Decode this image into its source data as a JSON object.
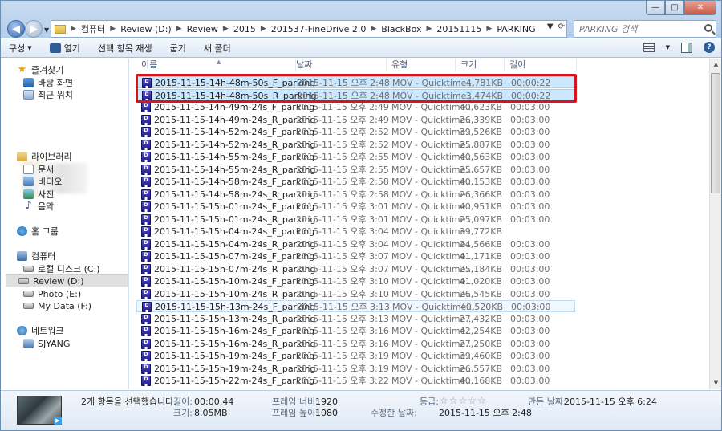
{
  "window": {
    "minimize": "—",
    "maximize": "□",
    "close": "✕"
  },
  "address": {
    "crumbs": [
      "컴퓨터",
      "Review (D:)",
      "Review",
      "2015",
      "201537-FineDrive 2.0",
      "BlackBox",
      "20151115",
      "PARKING"
    ]
  },
  "search": {
    "placeholder": "PARKING 검색"
  },
  "toolbar": {
    "organize": "구성",
    "open": "열기",
    "play_selection": "선택 항목 재생",
    "burn": "굽기",
    "new_folder": "새 폴더"
  },
  "sidebar": {
    "favorites": "즐겨찾기",
    "desktop": "바탕 화면",
    "recent": "최근 위치",
    "libraries": "라이브러리",
    "documents": "문서",
    "videos": "비디오",
    "pictures": "사진",
    "music": "음악",
    "homegroup": "홈 그룹",
    "computer": "컴퓨터",
    "local_disk": "로컬 디스크 (C:)",
    "review_drive": "Review (D:)",
    "photo_drive": "Photo (E:)",
    "mydata_drive": "My Data (F:)",
    "network": "네트워크",
    "host": "SJYANG"
  },
  "columns": {
    "name": "이름",
    "date": "날짜",
    "type": "유형",
    "size": "크기",
    "length": "길이"
  },
  "files": [
    {
      "name": "2015-11-15-14h-48m-50s_F_parking",
      "date": "2015-11-15 오후 2:48",
      "type": "MOV - Quicktime...",
      "size": "4,781KB",
      "length": "00:00:22"
    },
    {
      "name": "2015-11-15-14h-48m-50s_R_parking",
      "date": "2015-11-15 오후 2:48",
      "type": "MOV - Quicktime...",
      "size": "3,474KB",
      "length": "00:00:22"
    },
    {
      "name": "2015-11-15-14h-49m-24s_F_parking",
      "date": "2015-11-15 오후 2:49",
      "type": "MOV - Quicktime...",
      "size": "40,623KB",
      "length": "00:03:00"
    },
    {
      "name": "2015-11-15-14h-49m-24s_R_parking",
      "date": "2015-11-15 오후 2:49",
      "type": "MOV - Quicktime...",
      "size": "26,339KB",
      "length": "00:03:00"
    },
    {
      "name": "2015-11-15-14h-52m-24s_F_parking",
      "date": "2015-11-15 오후 2:52",
      "type": "MOV - Quicktime...",
      "size": "39,526KB",
      "length": "00:03:00"
    },
    {
      "name": "2015-11-15-14h-52m-24s_R_parking",
      "date": "2015-11-15 오후 2:52",
      "type": "MOV - Quicktime...",
      "size": "25,887KB",
      "length": "00:03:00"
    },
    {
      "name": "2015-11-15-14h-55m-24s_F_parking",
      "date": "2015-11-15 오후 2:55",
      "type": "MOV - Quicktime...",
      "size": "40,563KB",
      "length": "00:03:00"
    },
    {
      "name": "2015-11-15-14h-55m-24s_R_parking",
      "date": "2015-11-15 오후 2:55",
      "type": "MOV - Quicktime...",
      "size": "25,657KB",
      "length": "00:03:00"
    },
    {
      "name": "2015-11-15-14h-58m-24s_F_parking",
      "date": "2015-11-15 오후 2:58",
      "type": "MOV - Quicktime...",
      "size": "40,153KB",
      "length": "00:03:00"
    },
    {
      "name": "2015-11-15-14h-58m-24s_R_parking",
      "date": "2015-11-15 오후 2:58",
      "type": "MOV - Quicktime...",
      "size": "26,366KB",
      "length": "00:03:00"
    },
    {
      "name": "2015-11-15-15h-01m-24s_F_parking",
      "date": "2015-11-15 오후 3:01",
      "type": "MOV - Quicktime...",
      "size": "40,951KB",
      "length": "00:03:00"
    },
    {
      "name": "2015-11-15-15h-01m-24s_R_parking",
      "date": "2015-11-15 오후 3:01",
      "type": "MOV - Quicktime...",
      "size": "25,097KB",
      "length": "00:03:00"
    },
    {
      "name": "2015-11-15-15h-04m-24s_F_parking",
      "date": "2015-11-15 오후 3:04",
      "type": "MOV - Quicktime...",
      "size": "39,772KB",
      "length": ""
    },
    {
      "name": "2015-11-15-15h-04m-24s_R_parking",
      "date": "2015-11-15 오후 3:04",
      "type": "MOV - Quicktime...",
      "size": "24,566KB",
      "length": "00:03:00"
    },
    {
      "name": "2015-11-15-15h-07m-24s_F_parking",
      "date": "2015-11-15 오후 3:07",
      "type": "MOV - Quicktime...",
      "size": "41,171KB",
      "length": "00:03:00"
    },
    {
      "name": "2015-11-15-15h-07m-24s_R_parking",
      "date": "2015-11-15 오후 3:07",
      "type": "MOV - Quicktime...",
      "size": "25,184KB",
      "length": "00:03:00"
    },
    {
      "name": "2015-11-15-15h-10m-24s_F_parking",
      "date": "2015-11-15 오후 3:10",
      "type": "MOV - Quicktime...",
      "size": "41,020KB",
      "length": "00:03:00"
    },
    {
      "name": "2015-11-15-15h-10m-24s_R_parking",
      "date": "2015-11-15 오후 3:10",
      "type": "MOV - Quicktime...",
      "size": "26,545KB",
      "length": "00:03:00"
    },
    {
      "name": "2015-11-15-15h-13m-24s_F_parking",
      "date": "2015-11-15 오후 3:13",
      "type": "MOV - Quicktime...",
      "size": "40,520KB",
      "length": "00:03:00"
    },
    {
      "name": "2015-11-15-15h-13m-24s_R_parking",
      "date": "2015-11-15 오후 3:13",
      "type": "MOV - Quicktime...",
      "size": "27,432KB",
      "length": "00:03:00"
    },
    {
      "name": "2015-11-15-15h-16m-24s_F_parking",
      "date": "2015-11-15 오후 3:16",
      "type": "MOV - Quicktime...",
      "size": "42,254KB",
      "length": "00:03:00"
    },
    {
      "name": "2015-11-15-15h-16m-24s_R_parking",
      "date": "2015-11-15 오후 3:16",
      "type": "MOV - Quicktime...",
      "size": "27,250KB",
      "length": "00:03:00"
    },
    {
      "name": "2015-11-15-15h-19m-24s_F_parking",
      "date": "2015-11-15 오후 3:19",
      "type": "MOV - Quicktime...",
      "size": "39,460KB",
      "length": "00:03:00"
    },
    {
      "name": "2015-11-15-15h-19m-24s_R_parking",
      "date": "2015-11-15 오후 3:19",
      "type": "MOV - Quicktime...",
      "size": "26,557KB",
      "length": "00:03:00"
    },
    {
      "name": "2015-11-15-15h-22m-24s_F_parking",
      "date": "2015-11-15 오후 3:22",
      "type": "MOV - Quicktime...",
      "size": "40,168KB",
      "length": "00:03:00"
    }
  ],
  "details": {
    "summary": "2개 항목을 선택했습니다.",
    "length_label": "길이:",
    "length_value": "00:00:44",
    "size_label": "크기:",
    "size_value": "8.05MB",
    "frame_width_label": "프레임 너비:",
    "frame_width_value": "1920",
    "frame_height_label": "프레임 높이:",
    "frame_height_value": "1080",
    "rating_label": "등급:",
    "rating_stars": "☆☆☆☆☆",
    "modified_label": "수정한 날짜:",
    "modified_value": "2015-11-15 오후 2:48",
    "created_label": "만든 날짜:",
    "created_value": "2015-11-15 오후 6:24"
  },
  "colors": {
    "selection": "#cce8ff",
    "selection_border": "#99d1ff",
    "highlight_box": "#d8141f"
  }
}
